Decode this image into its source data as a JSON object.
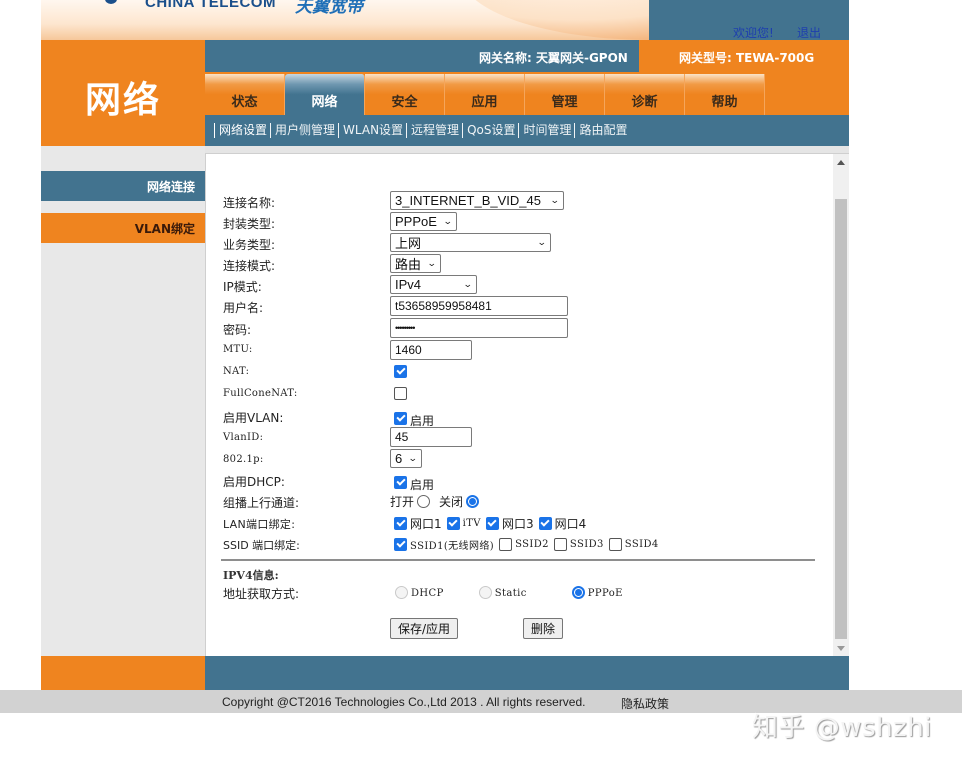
{
  "header": {
    "brand_text": "CHINA TELECOM",
    "brand_script": "天翼宽带",
    "welcome": "欢迎您!",
    "logout": "退出",
    "gateway_name": "网关名称:  天翼网关-GPON",
    "gateway_model": "网关型号: TEWA-700G"
  },
  "section_title": "网络",
  "tabs": [
    {
      "label": "状态",
      "active": false
    },
    {
      "label": "网络",
      "active": true
    },
    {
      "label": "安全",
      "active": false
    },
    {
      "label": "应用",
      "active": false
    },
    {
      "label": "管理",
      "active": false
    },
    {
      "label": "诊断",
      "active": false
    },
    {
      "label": "帮助",
      "active": false
    }
  ],
  "subnav": [
    {
      "label": "网络设置",
      "active": true
    },
    {
      "label": "用户侧管理",
      "active": false
    },
    {
      "label": "WLAN设置",
      "active": false
    },
    {
      "label": "远程管理",
      "active": false
    },
    {
      "label": "QoS设置",
      "active": false
    },
    {
      "label": "时间管理",
      "active": false
    },
    {
      "label": "路由配置",
      "active": false
    }
  ],
  "sidenav": [
    {
      "label": "网络连接",
      "active": true
    },
    {
      "label": "VLAN绑定",
      "active": false
    }
  ],
  "form": {
    "connection_name": {
      "label": "连接名称:",
      "value": "3_INTERNET_B_VID_45"
    },
    "encap_type": {
      "label": "封装类型:",
      "value": "PPPoE"
    },
    "service_type": {
      "label": "业务类型:",
      "value": "上网"
    },
    "connection_mode": {
      "label": "连接模式:",
      "value": "路由"
    },
    "ip_mode": {
      "label": "IP模式:",
      "value": "IPv4"
    },
    "username": {
      "label": "用户名:",
      "value": "t53658959958481"
    },
    "password": {
      "label": "密码:",
      "value": "•••••••••"
    },
    "mtu": {
      "label": "MTU:",
      "value": "1460"
    },
    "nat": {
      "label": "NAT:",
      "checked": true
    },
    "fullcone_nat": {
      "label": "FullConeNAT:",
      "checked": false
    },
    "enable_vlan": {
      "label": "启用VLAN:",
      "checked": true,
      "option_label": "启用"
    },
    "vlan_id": {
      "label": "VlanID:",
      "value": "45"
    },
    "dot1p": {
      "label": "802.1p:",
      "value": "6"
    },
    "enable_dhcp": {
      "label": "启用DHCP:",
      "checked": true,
      "option_label": "启用"
    },
    "multicast_upstream": {
      "label": "组播上行通道:",
      "options": [
        {
          "label": "打开",
          "selected": false
        },
        {
          "label": "关闭",
          "selected": true
        }
      ]
    },
    "lan_binding": {
      "label": "LAN端口绑定:",
      "ports": [
        {
          "label": "网口1",
          "checked": true
        },
        {
          "label": "iTV",
          "checked": true
        },
        {
          "label": "网口3",
          "checked": true
        },
        {
          "label": "网口4",
          "checked": true
        }
      ]
    },
    "ssid_binding": {
      "label": "SSID 端口绑定:",
      "ssids": [
        {
          "label": "SSID1(无线网络)",
          "checked": true
        },
        {
          "label": "SSID2",
          "checked": false
        },
        {
          "label": "SSID3",
          "checked": false
        },
        {
          "label": "SSID4",
          "checked": false
        }
      ]
    },
    "ipv4_section_title": "IPV4信息:",
    "address_method": {
      "label": "地址获取方式:",
      "options": [
        {
          "label": "DHCP",
          "selected": false,
          "disabled": true
        },
        {
          "label": "Static",
          "selected": false,
          "disabled": true
        },
        {
          "label": "PPPoE",
          "selected": true,
          "disabled": false
        }
      ]
    },
    "save_button": "保存/应用",
    "delete_button": "删除"
  },
  "footer": {
    "copyright": "Copyright @CT2016 Technologies Co.,Ltd 2013 . All rights reserved.",
    "privacy": "隐私政策"
  },
  "watermark": "知乎 @wshzhi",
  "colors": {
    "orange": "#ef841f",
    "steel_blue": "#42738f",
    "checkbox_blue": "#1a73e8",
    "link_blue": "#1e3fae"
  }
}
